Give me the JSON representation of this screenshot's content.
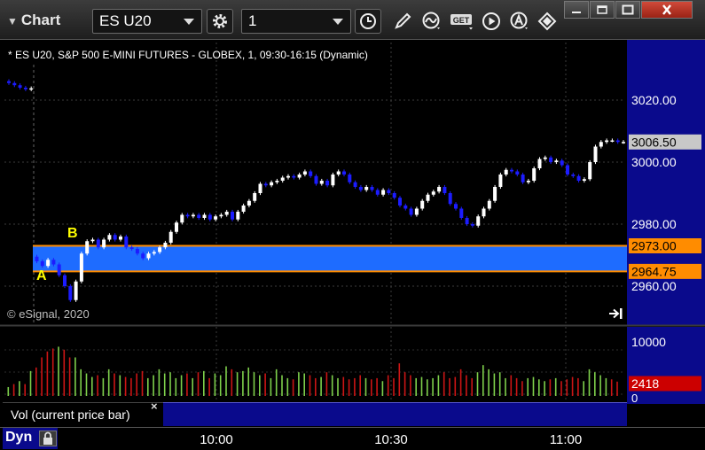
{
  "window": {
    "title": "Chart",
    "symbol": "ES U20",
    "interval": "1"
  },
  "chart_header": "* ES U20, S&P 500 E-MINI FUTURES - GLOBEX, 1, 09:30-16:15 (Dynamic)",
  "copyright": "© eSignal, 2020",
  "annotations": {
    "a": "A",
    "b": "B"
  },
  "volume_panel": {
    "title": "Vol (current price bar)",
    "close_label": "×",
    "current_value": "2418",
    "axis_max_label": "10000",
    "axis_min_label": "0"
  },
  "bottom_bar": {
    "dyn_label": "Dyn"
  },
  "price_tags": {
    "last": "3006.50",
    "zone_top": "2973.00",
    "zone_bottom": "2964.75"
  },
  "colors": {
    "background": "#000000",
    "axis_background": "#0a0a8c",
    "up_bar": "#ffffff",
    "down_bar": "#1c1cff",
    "zone_fill": "#1e6cff",
    "zone_line": "#ff8c00",
    "last_tag": "#c8c8c8",
    "vol_up": "#7ed04b",
    "vol_down": "#cc1515",
    "vol_tag": "#cc0000",
    "annotation": "#ffff00"
  },
  "chart_data": [
    {
      "type": "candlestick",
      "title": "* ES U20, S&P 500 E-MINI FUTURES - GLOBEX, 1, 09:30-16:15 (Dynamic)",
      "y_ticks": [
        3020,
        3000,
        2980,
        2960
      ],
      "y_tick_labels": [
        "3020.00",
        "3000.00",
        "2980.00",
        "2960.00"
      ],
      "ylim": [
        2953,
        3028
      ],
      "x_ticks": [
        "10:00",
        "10:30",
        "11:00"
      ],
      "grid": true,
      "last_price": 3006.5,
      "zone": {
        "top": 2973.0,
        "bottom": 2964.75
      },
      "annotations": [
        {
          "text": "A",
          "near_price": 2962
        },
        {
          "text": "B",
          "near_price": 2975
        }
      ],
      "prices": [
        3025.5,
        3024.8,
        3024,
        3023.5,
        3023.8,
        2968,
        2966.5,
        2968.5,
        2967,
        2963.5,
        2960,
        2955.5,
        2961.5,
        2970.5,
        2974.5,
        2975,
        2972.5,
        2975,
        2976.5,
        2975,
        2976,
        2972.5,
        2972,
        2970.5,
        2969,
        2970.5,
        2971,
        2972.5,
        2974,
        2977.5,
        2980.5,
        2983,
        2982.5,
        2983,
        2982,
        2983,
        2981.5,
        2982.5,
        2983,
        2984,
        2981.5,
        2984,
        2986,
        2987.5,
        2990,
        2993,
        2992.5,
        2993.5,
        2994,
        2995,
        2995.5,
        2995,
        2996,
        2997,
        2995.5,
        2993,
        2994,
        2992.5,
        2996,
        2997,
        2996,
        2993.5,
        2992,
        2991,
        2992,
        2991,
        2989.5,
        2991,
        2990,
        2988.5,
        2986,
        2985,
        2983,
        2985,
        2987.5,
        2989.5,
        2990.5,
        2992,
        2990,
        2986.5,
        2985,
        2982,
        2980,
        2979.5,
        2982.5,
        2985,
        2987.5,
        2992,
        2996,
        2997.5,
        2997,
        2996,
        2993.5,
        2994,
        2998,
        3001,
        3001.5,
        3000,
        3000.5,
        2999,
        2996,
        2995.5,
        2994,
        2994.5,
        3000,
        3005,
        3006.5,
        3007,
        3007,
        3006.5,
        3006.5
      ]
    },
    {
      "type": "bar",
      "title": "Vol (current price bar)",
      "ylim": [
        0,
        11200
      ],
      "y_tick_labels": [
        "10000",
        "0"
      ],
      "current_value": 2418,
      "values": [
        1500,
        2000,
        2500,
        2000,
        4200,
        4800,
        6500,
        7500,
        8000,
        8300,
        7800,
        6500,
        6500,
        4500,
        3800,
        3200,
        3500,
        3000,
        4500,
        3800,
        3500,
        3200,
        3000,
        3800,
        4200,
        3000,
        3500,
        4500,
        3800,
        4000,
        3000,
        3500,
        3800,
        3000,
        4000,
        4200,
        3000,
        3800,
        3500,
        5000,
        4500,
        4000,
        4200,
        4800,
        4000,
        3500,
        3800,
        3000,
        4500,
        3500,
        3000,
        2800,
        4000,
        3800,
        3500,
        3000,
        3200,
        4000,
        3500,
        3000,
        3200,
        2800,
        3000,
        3500,
        3000,
        2800,
        3000,
        2500,
        3500,
        3000,
        5500,
        4000,
        3500,
        3000,
        3200,
        2800,
        3000,
        3500,
        4000,
        3000,
        3200,
        4500,
        3500,
        3000,
        4000,
        5200,
        4500,
        3800,
        4000,
        3000,
        3500,
        3000,
        2500,
        3000,
        3200,
        2800,
        2500,
        2800,
        3000,
        2500,
        2800,
        3200,
        3000,
        2500,
        4500,
        4000,
        3500,
        3000,
        2800,
        2418
      ],
      "up": [
        1,
        0,
        1,
        0,
        1,
        0,
        0,
        0,
        0,
        1,
        0,
        0,
        1,
        1,
        1,
        1,
        0,
        1,
        1,
        0,
        1,
        0,
        0,
        0,
        0,
        1,
        1,
        1,
        1,
        1,
        1,
        1,
        0,
        1,
        0,
        1,
        0,
        1,
        1,
        1,
        0,
        1,
        1,
        1,
        1,
        1,
        0,
        1,
        1,
        1,
        1,
        0,
        1,
        1,
        0,
        0,
        1,
        0,
        1,
        1,
        0,
        0,
        0,
        0,
        1,
        0,
        0,
        1,
        0,
        0,
        0,
        0,
        0,
        1,
        1,
        1,
        1,
        1,
        0,
        0,
        0,
        0,
        0,
        0,
        1,
        1,
        1,
        1,
        1,
        1,
        0,
        0,
        0,
        1,
        1,
        1,
        1,
        0,
        1,
        0,
        0,
        0,
        0,
        1,
        1,
        1,
        1,
        1,
        0,
        0
      ]
    }
  ]
}
